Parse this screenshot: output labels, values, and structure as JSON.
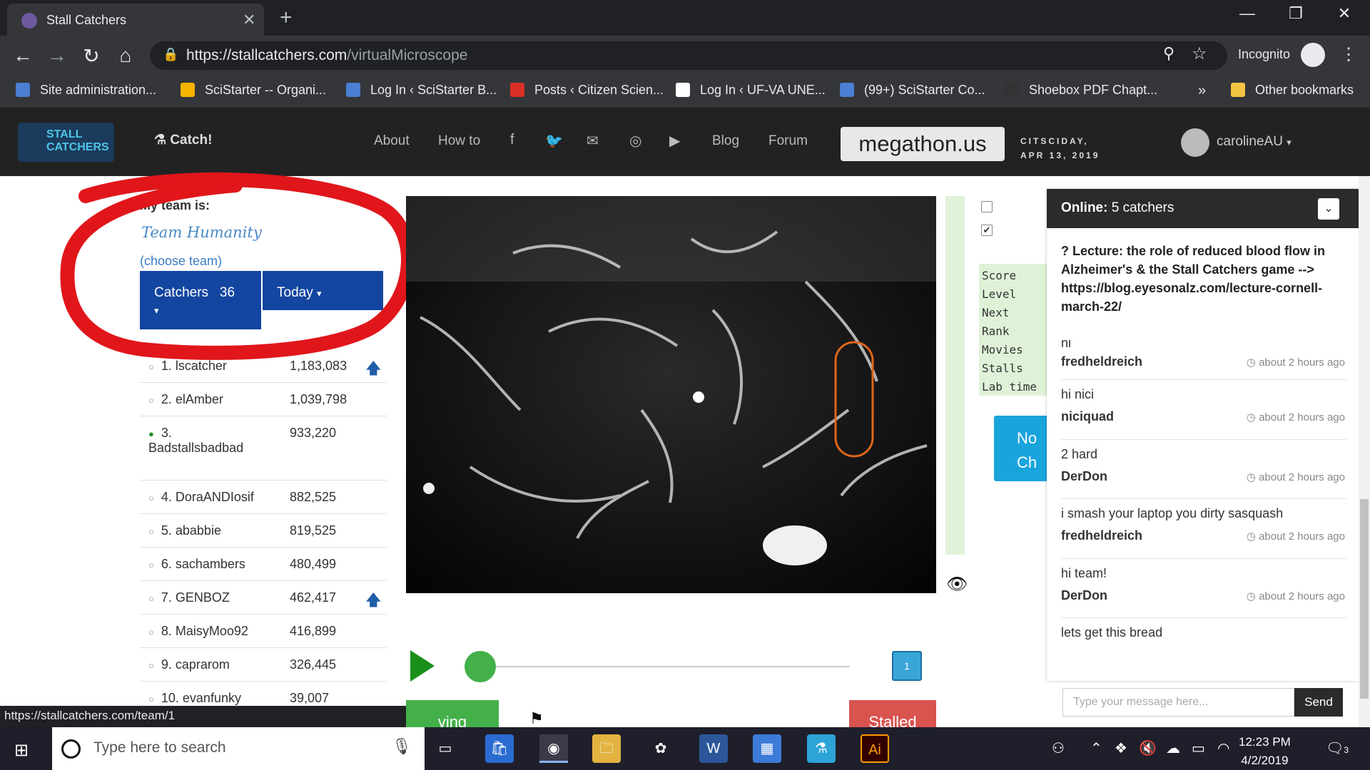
{
  "browser": {
    "tab_title": "Stall Catchers",
    "new_tab": "+",
    "url_host": "https://stallcatchers.com",
    "url_path": "/virtualMicroscope",
    "incognito": "Incognito",
    "bookmarks": [
      {
        "label": "Site administration...",
        "color": "#4a7fd4"
      },
      {
        "label": "SciStarter -- Organi...",
        "color": "#f4b400"
      },
      {
        "label": "Log In ‹ SciStarter B...",
        "color": "#4a7fd4"
      },
      {
        "label": "Posts ‹ Citizen Scien...",
        "color": "#d93025"
      },
      {
        "label": "Log In ‹ UF-VA UNE...",
        "color": "#ffffff"
      },
      {
        "label": "(99+) SciStarter Co...",
        "color": "#4a7fd4"
      },
      {
        "label": "Shoebox PDF Chapt...",
        "color": "#333333"
      }
    ],
    "bookmarks_overflow": "»",
    "other_bookmarks": "Other bookmarks",
    "status_url": "https://stallcatchers.com/team/1"
  },
  "site": {
    "logo_text": "STALL CATCHERS",
    "catch": "Catch!",
    "nav": [
      "About",
      "How to",
      "Blog",
      "Forum"
    ],
    "social_icons": [
      "facebook-icon",
      "twitter-icon",
      "mail-icon",
      "instagram-icon",
      "youtube-icon"
    ],
    "megathon": "megathon.us",
    "citsciday_line1": "CITSCIDAY,",
    "citsciday_line2": "APR 13, 2019",
    "username": "carolineAU"
  },
  "team": {
    "label": "My team is:",
    "name": "Team Humanity",
    "choose": "(choose team)",
    "catchers_label": "Catchers",
    "catchers_count": "36",
    "period": "Today"
  },
  "leaderboard": [
    {
      "rank": "1.",
      "name": "lscatcher",
      "score": "1,183,083",
      "arrow": true,
      "online": false
    },
    {
      "rank": "2.",
      "name": "elAmber",
      "score": "1,039,798",
      "arrow": false,
      "online": false
    },
    {
      "rank": "3.",
      "name": "Badstallsbadbad",
      "score": "933,220",
      "arrow": false,
      "online": true
    },
    {
      "rank": "4.",
      "name": "DoraANDIosif",
      "score": "882,525",
      "arrow": false,
      "online": false
    },
    {
      "rank": "5.",
      "name": "ababbie",
      "score": "819,525",
      "arrow": false,
      "online": false
    },
    {
      "rank": "6.",
      "name": "sachambers",
      "score": "480,499",
      "arrow": false,
      "online": false
    },
    {
      "rank": "7.",
      "name": "GENBOZ",
      "score": "462,417",
      "arrow": true,
      "online": false
    },
    {
      "rank": "8.",
      "name": "MaisyMoo92",
      "score": "416,899",
      "arrow": false,
      "online": false
    },
    {
      "rank": "9.",
      "name": "caprarom",
      "score": "326,445",
      "arrow": false,
      "online": false
    },
    {
      "rank": "10.",
      "name": "evanfunky",
      "score": "39,007",
      "arrow": false,
      "online": false
    }
  ],
  "microscope": {
    "checkbox_1": false,
    "checkbox_2": true,
    "stats_labels": [
      "Score",
      "Level",
      "Next",
      "Rank",
      "Movies",
      "Stalls",
      "Lab time"
    ],
    "blue_button_line1": "No",
    "blue_button_line2": "Ch",
    "frame_number": "1",
    "slider_progress": 0,
    "flowing_label": "ving",
    "stalled_label": "Stalled"
  },
  "chat": {
    "online_label": "Online:",
    "online_count": "5 catchers",
    "lecture": "? Lecture: the role of reduced blood flow in Alzheimer's & the Stall Catchers game --> https://blog.eyesonalz.com/lecture-cornell-march-22/",
    "messages": [
      {
        "text": "hi",
        "user": "fredheldreich",
        "time": "about 2 hours ago"
      },
      {
        "text": "hi nici",
        "user": "niciquad",
        "time": "about 2 hours ago"
      },
      {
        "text": "2 hard",
        "user": "DerDon",
        "time": "about 2 hours ago"
      },
      {
        "text": "i smash your laptop you dirty sasquash",
        "user": "fredheldreich",
        "time": "about 2 hours ago"
      },
      {
        "text": "hi team!",
        "user": "DerDon",
        "time": "about 2 hours ago"
      },
      {
        "text": "lets get this bread",
        "user": "",
        "time": ""
      }
    ],
    "input_placeholder": "Type your message here...",
    "send": "Send"
  },
  "taskbar": {
    "search_placeholder": "Type here to search",
    "time": "12:23 PM",
    "date": "4/2/2019",
    "notifications": "3"
  }
}
